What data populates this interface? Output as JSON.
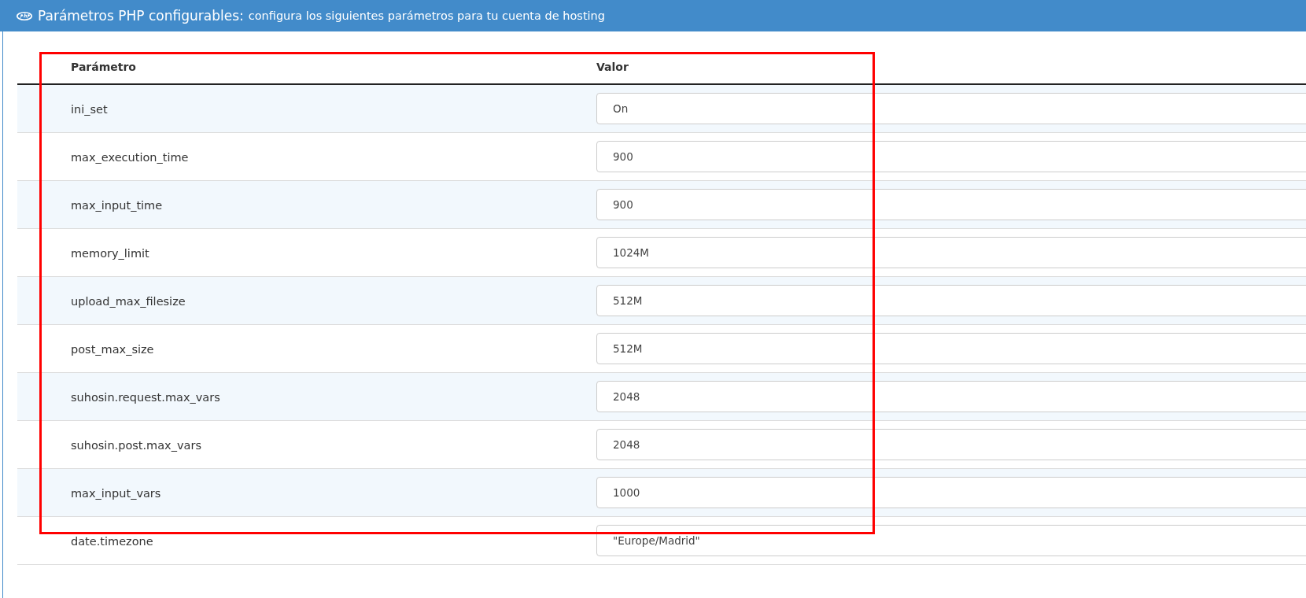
{
  "header": {
    "title": "Parámetros PHP configurables:",
    "subtitle": "configura los siguientes parámetros para tu cuenta de hosting"
  },
  "table": {
    "columns": [
      "Parámetro",
      "Valor"
    ],
    "rows": [
      {
        "name": "ini_set",
        "value": "On"
      },
      {
        "name": "max_execution_time",
        "value": "900"
      },
      {
        "name": "max_input_time",
        "value": "900"
      },
      {
        "name": "memory_limit",
        "value": "1024M"
      },
      {
        "name": "upload_max_filesize",
        "value": "512M"
      },
      {
        "name": "post_max_size",
        "value": "512M"
      },
      {
        "name": "suhosin.request.max_vars",
        "value": "2048"
      },
      {
        "name": "suhosin.post.max_vars",
        "value": "2048"
      },
      {
        "name": "max_input_vars",
        "value": "1000"
      },
      {
        "name": "date.timezone",
        "value": "\"Europe/Madrid\""
      }
    ]
  }
}
